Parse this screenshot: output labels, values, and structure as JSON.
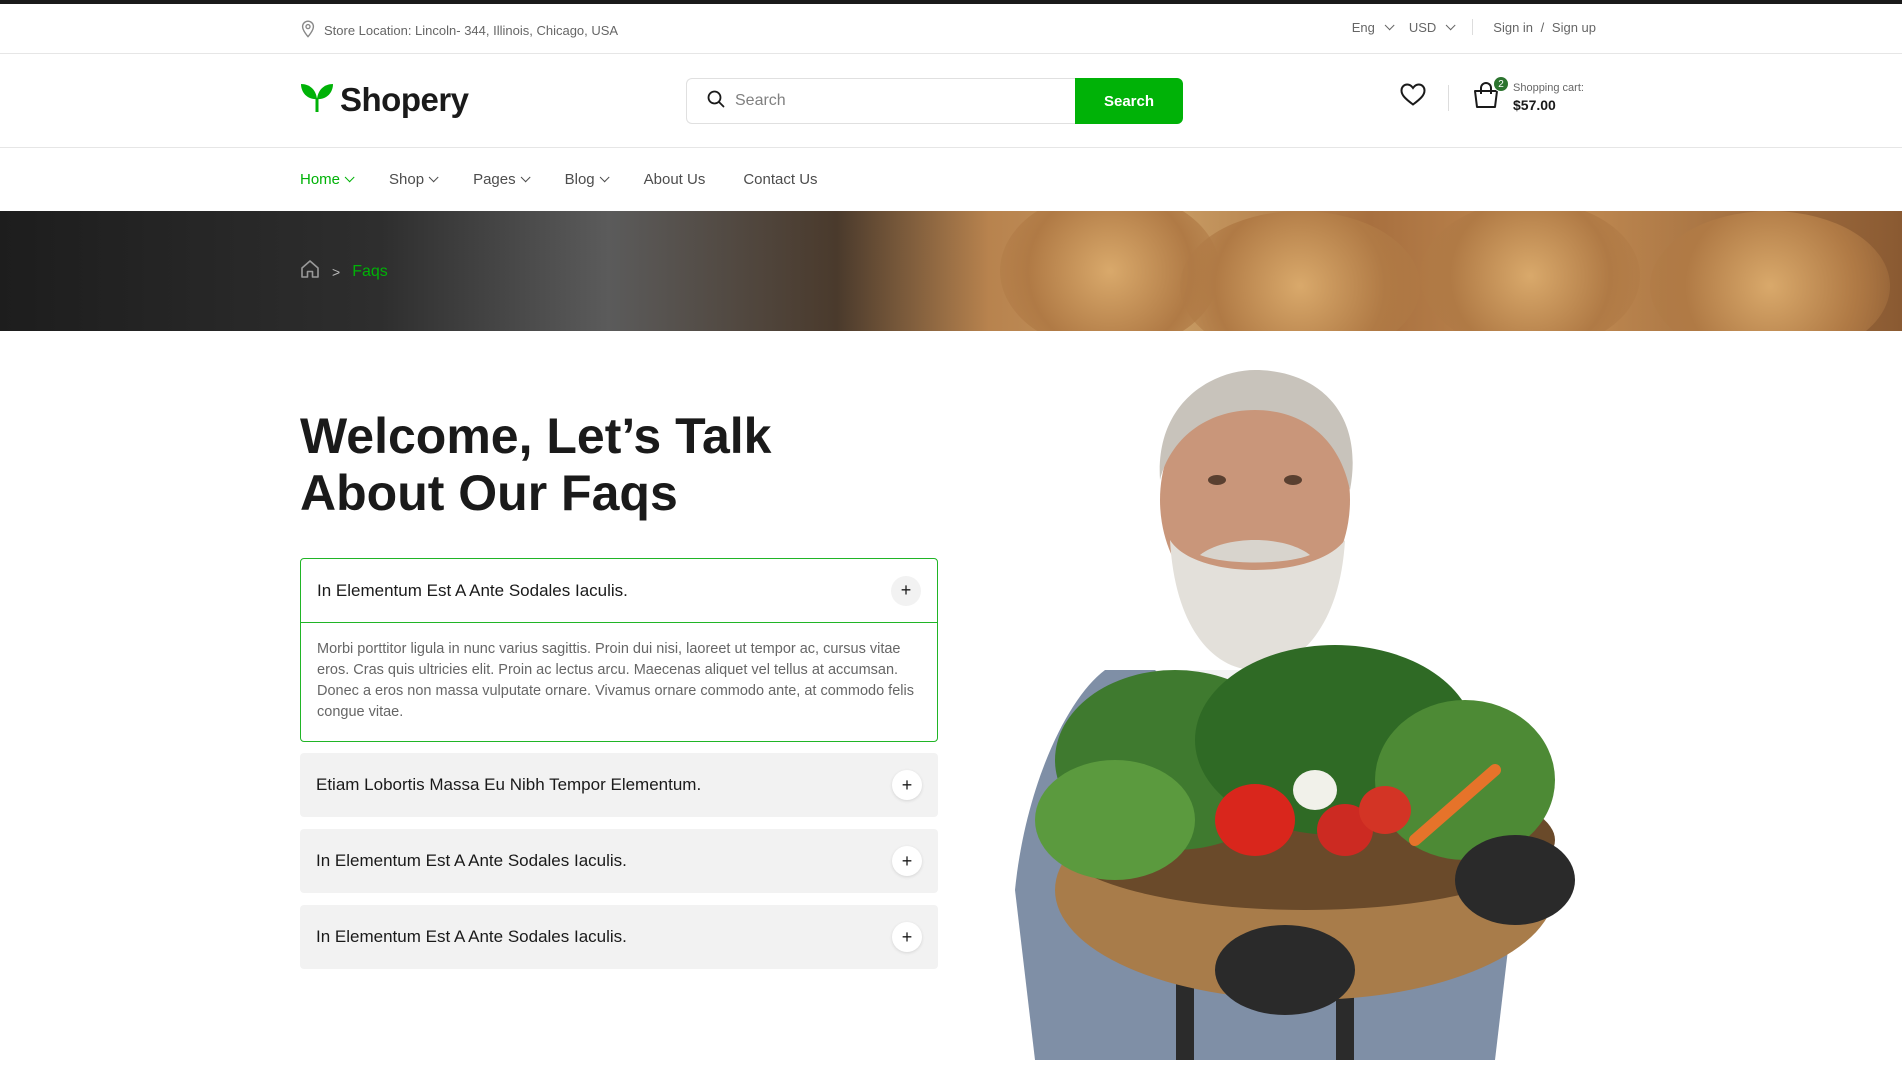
{
  "topbar": {
    "location": "Store Location: Lincoln- 344, Illinois, Chicago, USA",
    "language": "Eng",
    "currency": "USD",
    "sign_in": "Sign in",
    "divider": "/",
    "sign_up": "Sign up"
  },
  "header": {
    "logo": "Shopery",
    "search_placeholder": "Search",
    "search_button": "Search",
    "cart_count": "2",
    "cart_label": "Shopping cart:",
    "cart_total": "$57.00"
  },
  "nav": {
    "items": [
      {
        "label": "Home",
        "dropdown": true
      },
      {
        "label": "Shop",
        "dropdown": true
      },
      {
        "label": "Pages",
        "dropdown": true
      },
      {
        "label": "Blog",
        "dropdown": true
      },
      {
        "label": "About Us",
        "dropdown": false
      },
      {
        "label": "Contact Us",
        "dropdown": false
      }
    ]
  },
  "breadcrumb": {
    "home_icon": "home-icon",
    "separator": ">",
    "current": "Faqs"
  },
  "main": {
    "title_line1": "Welcome, Let’s Talk",
    "title_line2": "About Our Faqs",
    "faqs": [
      {
        "question": "In Elementum Est A Ante Sodales Iaculis.",
        "answer": "Morbi porttitor ligula in nunc varius sagittis. Proin dui nisi, laoreet ut tempor ac, cursus vitae eros. Cras quis ultricies elit. Proin ac lectus arcu. Maecenas aliquet vel tellus at accumsan. Donec a eros non massa vulputate ornare. Vivamus ornare commodo ante, at commodo felis congue vitae.",
        "expanded": true
      },
      {
        "question": "Etiam Lobortis Massa Eu Nibh Tempor Elementum.",
        "expanded": false
      },
      {
        "question": "In Elementum Est A Ante Sodales Iaculis.",
        "expanded": false
      },
      {
        "question": "In Elementum Est A Ante Sodales Iaculis.",
        "expanded": false
      }
    ],
    "toggle_symbol": "+"
  },
  "colors": {
    "brand_green": "#00b207",
    "dark_green": "#2c742f",
    "accordion_border": "#20b526"
  },
  "icons": [
    "map-pin-icon",
    "chevron-down-icon",
    "leaf-logo-icon",
    "search-icon",
    "heart-icon",
    "shopping-bag-icon",
    "home-icon",
    "plus-icon"
  ]
}
